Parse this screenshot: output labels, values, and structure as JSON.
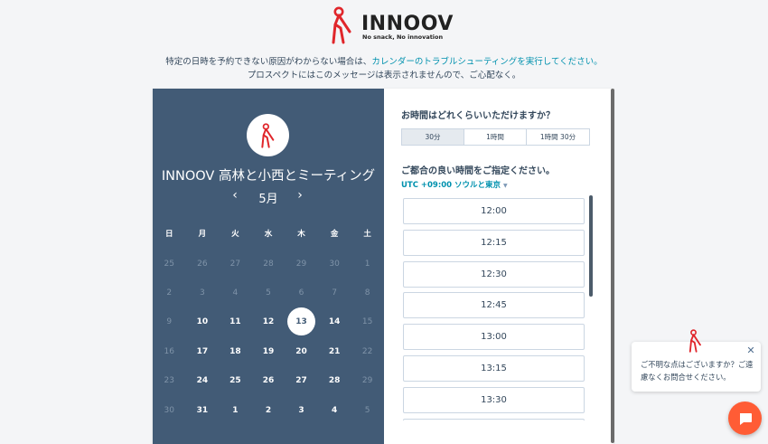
{
  "brand": {
    "name": "INNOOV",
    "tagline": "No snack, No innovation",
    "accent": "#e0262b"
  },
  "notice": {
    "line1_prefix": "特定の日時を予約できない原因がわからない場合は、",
    "line1_link": "カレンダーのトラブルシューティングを実行してください。",
    "line2": "プロスペクトにはこのメッセージは表示されませんので、ご心配なく。"
  },
  "calendar": {
    "meeting_title": "INNOOV 高林と小西とミーティング",
    "month": "5月",
    "prev_icon": "‹",
    "next_icon": "›",
    "weekdays": [
      "日",
      "月",
      "火",
      "水",
      "木",
      "金",
      "土"
    ],
    "weeks": [
      [
        [
          "25",
          "muted"
        ],
        [
          "26",
          "muted"
        ],
        [
          "27",
          "muted"
        ],
        [
          "28",
          "muted"
        ],
        [
          "29",
          "muted"
        ],
        [
          "30",
          "muted"
        ],
        [
          "1",
          "muted"
        ]
      ],
      [
        [
          "2",
          "muted"
        ],
        [
          "3",
          "muted"
        ],
        [
          "4",
          "muted"
        ],
        [
          "5",
          "muted"
        ],
        [
          "6",
          "muted"
        ],
        [
          "7",
          "muted"
        ],
        [
          "8",
          "muted"
        ]
      ],
      [
        [
          "9",
          "muted"
        ],
        [
          "10",
          "active"
        ],
        [
          "11",
          "active"
        ],
        [
          "12",
          "active"
        ],
        [
          "13",
          "selected"
        ],
        [
          "14",
          "active"
        ],
        [
          "15",
          "muted"
        ]
      ],
      [
        [
          "16",
          "muted"
        ],
        [
          "17",
          "active"
        ],
        [
          "18",
          "active"
        ],
        [
          "19",
          "active"
        ],
        [
          "20",
          "active"
        ],
        [
          "21",
          "active"
        ],
        [
          "22",
          "muted"
        ]
      ],
      [
        [
          "23",
          "muted"
        ],
        [
          "24",
          "active"
        ],
        [
          "25",
          "active"
        ],
        [
          "26",
          "active"
        ],
        [
          "27",
          "active"
        ],
        [
          "28",
          "active"
        ],
        [
          "29",
          "muted"
        ]
      ],
      [
        [
          "30",
          "muted"
        ],
        [
          "31",
          "active"
        ],
        [
          "1",
          "active"
        ],
        [
          "2",
          "active"
        ],
        [
          "3",
          "active"
        ],
        [
          "4",
          "active"
        ],
        [
          "5",
          "muted"
        ]
      ]
    ],
    "panel_color": "#425b76"
  },
  "booking": {
    "duration_question": "お時間はどれくらいいただけますか？",
    "durations": [
      {
        "label": "30分",
        "selected": true
      },
      {
        "label": "1時間",
        "selected": false
      },
      {
        "label": "1時間 30分",
        "selected": false
      }
    ],
    "time_question": "ご都合の良い時間をご指定ください。",
    "timezone": "UTC +09:00 ソウルと東京",
    "timezone_caret": "▼",
    "slots": [
      "12:00",
      "12:15",
      "12:30",
      "12:45",
      "13:00",
      "13:15",
      "13:30",
      ""
    ]
  },
  "chat": {
    "message": "ご不明な点はございますか？ご遠慮なくお問合せください。",
    "close_icon": "✕",
    "launcher_color": "#ff5c35"
  }
}
